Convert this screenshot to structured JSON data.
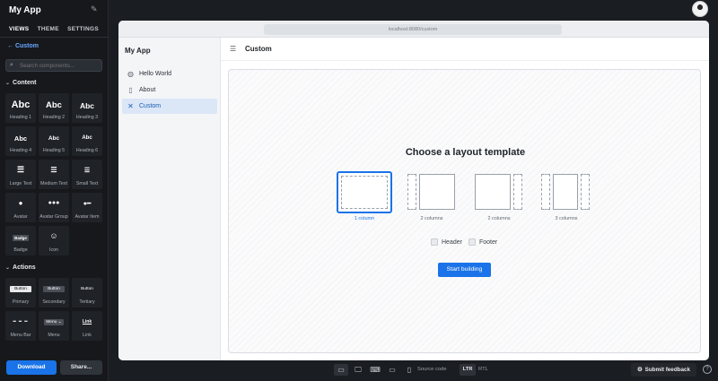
{
  "left_panel": {
    "title": "My App",
    "tabs": [
      "VIEWS",
      "THEME",
      "SETTINGS"
    ],
    "back_label": "Custom",
    "search_placeholder": "Search components...",
    "sections": {
      "content": {
        "title": "Content",
        "items": [
          {
            "preview": "Abc",
            "label": "Heading 1"
          },
          {
            "preview": "Abc",
            "label": "Heading 2"
          },
          {
            "preview": "Abc",
            "label": "Heading 3"
          },
          {
            "preview": "Abc",
            "label": "Heading 4"
          },
          {
            "preview": "Abc",
            "label": "Heading 5"
          },
          {
            "preview": "Abc",
            "label": "Heading 6"
          },
          {
            "preview": "",
            "label": "Large Text"
          },
          {
            "preview": "",
            "label": "Medium Text"
          },
          {
            "preview": "",
            "label": "Small Text"
          },
          {
            "preview": "",
            "label": "Avatar"
          },
          {
            "preview": "",
            "label": "Avatar Group"
          },
          {
            "preview": "",
            "label": "Avatar Item"
          },
          {
            "preview": "Badge",
            "label": "Badge"
          },
          {
            "preview": "",
            "label": "Icon"
          }
        ]
      },
      "actions": {
        "title": "Actions",
        "items": [
          {
            "preview": "Button",
            "label": "Primary"
          },
          {
            "preview": "Button",
            "label": "Secondary"
          },
          {
            "preview": "Button",
            "label": "Tertiary"
          },
          {
            "preview": "",
            "label": "Menu Bar"
          },
          {
            "preview": "Menu ⌄",
            "label": "Menu"
          },
          {
            "preview": "Link",
            "label": "Link"
          }
        ]
      }
    },
    "download_label": "Download",
    "share_label": "Share..."
  },
  "browser": {
    "url": "localhost:8080/custom"
  },
  "app": {
    "title": "My App",
    "nav": [
      {
        "icon": "globe-icon",
        "label": "Hello World"
      },
      {
        "icon": "file-icon",
        "label": "About"
      },
      {
        "icon": "tools-icon",
        "label": "Custom"
      }
    ],
    "page_title": "Custom",
    "heading": "Choose a layout template",
    "templates": [
      {
        "label": "1 column"
      },
      {
        "label": "2 columns"
      },
      {
        "label": "2 columns"
      },
      {
        "label": "3 columns"
      }
    ],
    "header_option": "Header",
    "footer_option": "Footer",
    "start_label": "Start building"
  },
  "bottom_bar": {
    "source_code": "Source code",
    "ltr": "LTR",
    "rtl": "RTL",
    "feedback": "Submit feedback",
    "help": "?"
  },
  "colors": {
    "accent": "#1a73e8",
    "dark_bg": "#1a1d21",
    "nav_active_bg": "#dbe6f6"
  }
}
